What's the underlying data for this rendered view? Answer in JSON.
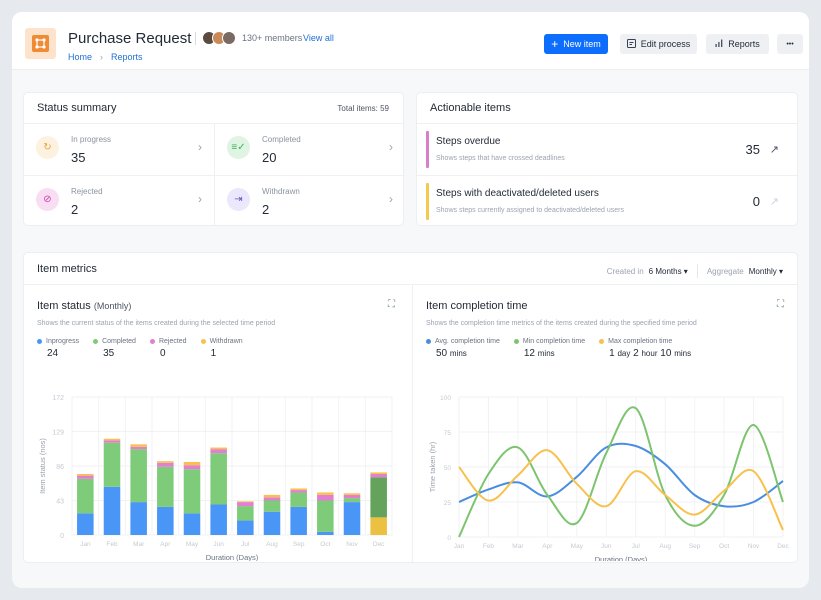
{
  "header": {
    "title": "Purchase Request",
    "members_label": "130+ members",
    "view_all": "View all",
    "breadcrumb": [
      "Home",
      "Reports"
    ],
    "buttons": {
      "new_item": "New item",
      "edit_process": "Edit process",
      "reports": "Reports",
      "more": "•••"
    },
    "avatar_colors": [
      "#5a4a40",
      "#c98a5a",
      "#7a6a64"
    ],
    "logo_color": "#f08a35"
  },
  "status_summary": {
    "title": "Status summary",
    "total_label": "Total items: 59",
    "items": [
      {
        "label": "In progress",
        "value": "35",
        "icon": "refresh-icon",
        "color": "#e9a23b",
        "bg": "#fdf1e0"
      },
      {
        "label": "Completed",
        "value": "20",
        "icon": "list-check-icon",
        "color": "#3fae5a",
        "bg": "#dff4e3"
      },
      {
        "label": "Rejected",
        "value": "2",
        "icon": "block-icon",
        "color": "#c23fb0",
        "bg": "#f9ddf3"
      },
      {
        "label": "Withdrawn",
        "value": "2",
        "icon": "exit-icon",
        "color": "#6456c9",
        "bg": "#ebe8fb"
      }
    ]
  },
  "actionable": {
    "title": "Actionable items",
    "items": [
      {
        "name": "Steps overdue",
        "desc": "Shows steps that have crossed deadlines",
        "value": "35",
        "color": "#d97fc9",
        "link_color": "#4b5563"
      },
      {
        "name": "Steps with deactivated/deleted users",
        "desc": "Shows steps currently assigned to deactivated/deleted users",
        "value": "0",
        "color": "#f3c94e",
        "link_color": "#c8d4e0"
      }
    ]
  },
  "metrics": {
    "title": "Item metrics",
    "created_in_label": "Created in",
    "created_in_value": "6 Months ▾",
    "aggregate_label": "Aggregate",
    "aggregate_value": "Monthly ▾",
    "status_chart": {
      "title": "Item status",
      "subtitle": "(Monthly)",
      "desc": "Shows the current status of the items created during the selected time period",
      "legend": [
        {
          "label": "Inprogress",
          "value": "24",
          "color": "#4a96f7"
        },
        {
          "label": "Completed",
          "value": "35",
          "color": "#7ecb7a"
        },
        {
          "label": "Rejected",
          "value": "0",
          "color": "#e27fd1"
        },
        {
          "label": "Withdrawn",
          "value": "1",
          "color": "#f7c14e"
        }
      ]
    },
    "time_chart": {
      "title": "Item completion time",
      "desc": "Shows the completion time metrics of the items created during the specified time period",
      "legend": [
        {
          "label": "Avg. completion time",
          "parts": [
            [
              "50",
              "mins"
            ]
          ],
          "color": "#4a8de0"
        },
        {
          "label": "Min completion time",
          "parts": [
            [
              "12",
              "mins"
            ]
          ],
          "color": "#7cc46e"
        },
        {
          "label": "Max completion time",
          "parts": [
            [
              "1",
              "day"
            ],
            [
              "2",
              "hour"
            ],
            [
              "10",
              "mins"
            ]
          ],
          "color": "#f7c14e"
        }
      ]
    }
  },
  "chart_data": [
    {
      "type": "bar",
      "stacked": true,
      "title": "Item status (Monthly)",
      "xlabel": "Duration (Days)",
      "ylabel": "Item status (nos)",
      "ylim": [
        0,
        172
      ],
      "yticks": [
        0,
        43,
        86,
        129,
        172
      ],
      "categories": [
        "Jan",
        "Feb",
        "Mar",
        "Apr",
        "May",
        "Jun",
        "Jul",
        "Aug",
        "Sep",
        "Oct",
        "Nov",
        "Dec"
      ],
      "series": [
        {
          "name": "Inprogress",
          "color": "#4a96f7",
          "values": [
            27,
            60,
            41,
            35,
            27,
            38,
            18,
            29,
            35,
            4,
            41,
            0
          ]
        },
        {
          "name": "Completed",
          "color": "#7ecb7a",
          "values": [
            43,
            55,
            66,
            50,
            55,
            64,
            18,
            14,
            18,
            39,
            5,
            0
          ]
        },
        {
          "name": "Rejected",
          "color": "#e27fd1",
          "values": [
            4,
            3,
            3,
            5,
            5,
            5,
            5,
            4,
            3,
            7,
            4,
            4
          ]
        },
        {
          "name": "Withdrawn",
          "color": "#f7c14e",
          "values": [
            2,
            2,
            3,
            2,
            4,
            2,
            1,
            3,
            2,
            3,
            2,
            2
          ]
        }
      ],
      "highlight": {
        "category": "Dec",
        "segments": [
          {
            "name": "Withdrawn",
            "value": 22,
            "color": "#ecc040"
          },
          {
            "name": "Completed",
            "value": 50,
            "color": "#64a35c"
          }
        ]
      },
      "grid": true
    },
    {
      "type": "line",
      "smooth": true,
      "title": "Item completion time",
      "xlabel": "Duration (Days)",
      "ylabel": "Time taken (hr)",
      "ylim": [
        0,
        100
      ],
      "yticks": [
        0,
        25,
        50,
        75,
        100
      ],
      "x": [
        "Jan",
        "Feb",
        "Mar",
        "Apr",
        "May",
        "Jun",
        "Jul",
        "Aug",
        "Sep",
        "Oct",
        "Nov",
        "Dec"
      ],
      "series": [
        {
          "name": "Avg. completion time",
          "color": "#4a8de0",
          "values": [
            25,
            34,
            39,
            29,
            43,
            64,
            65,
            52,
            30,
            22,
            25,
            40
          ]
        },
        {
          "name": "Min completion time",
          "color": "#7cc46e",
          "values": [
            0,
            45,
            64,
            30,
            10,
            60,
            92,
            30,
            8,
            30,
            80,
            25
          ]
        },
        {
          "name": "Max completion time",
          "color": "#f7c14e",
          "values": [
            50,
            26,
            44,
            62,
            38,
            22,
            47,
            30,
            16,
            33,
            47,
            5
          ]
        }
      ],
      "grid": true
    }
  ]
}
